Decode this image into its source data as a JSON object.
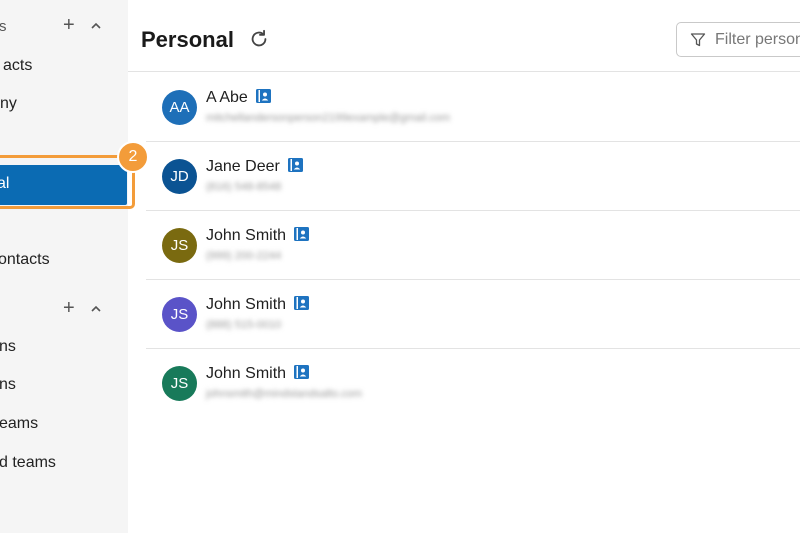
{
  "sidebar": {
    "section1": {
      "title": "rs",
      "plus": "+"
    },
    "section2": {
      "plus": "+"
    },
    "items": [
      {
        "label": "acts"
      },
      {
        "label": "ny"
      },
      {
        "label": "al"
      },
      {
        "label": "ontacts"
      },
      {
        "label": "ns"
      },
      {
        "label": "ns"
      },
      {
        "label": "eams"
      },
      {
        "label": "d teams"
      }
    ],
    "step_badge": "2"
  },
  "header": {
    "title": "Personal",
    "filter_placeholder": "Filter person"
  },
  "contacts": [
    {
      "initials": "AA",
      "name": "A Abe",
      "detail": "mitchellandersonperson2199example@gmail.com",
      "color": "#1e6fb8"
    },
    {
      "initials": "JD",
      "name": "Jane Deer",
      "detail": "(816) 548-8548",
      "color": "#0b5393"
    },
    {
      "initials": "JS",
      "name": "John Smith",
      "detail": "(999) 200-2244",
      "color": "#7a6a10"
    },
    {
      "initials": "JS",
      "name": "John Smith",
      "detail": "(888) 515-0010",
      "color": "#5a53c8"
    },
    {
      "initials": "JS",
      "name": "John Smith",
      "detail": "johnsmith@mindstandsalto.com",
      "color": "#187a5a"
    }
  ],
  "colors": {
    "accent": "#0b6bb3",
    "highlight": "#f39c3a",
    "badge_icon": "#1e73c0"
  },
  "icons": {
    "refresh": "refresh-icon",
    "filter": "filter-icon",
    "contact_card": "contact-card-icon",
    "chevron": "chevron-up-icon"
  }
}
